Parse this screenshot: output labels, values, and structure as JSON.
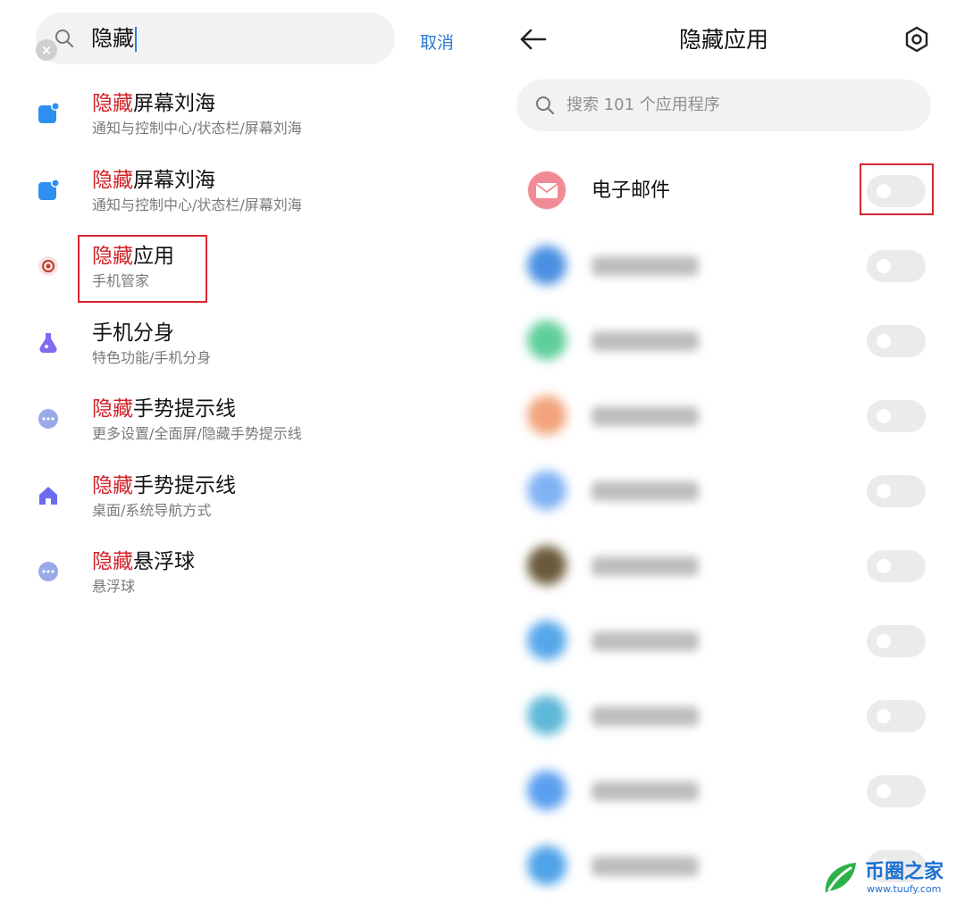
{
  "left": {
    "search": {
      "query": "隐藏",
      "cancel_label": "取消"
    },
    "results": [
      {
        "highlight": "隐藏",
        "rest": "屏幕刘海",
        "path": "通知与控制中心/状态栏/屏幕刘海",
        "icon": "notification-icon",
        "color": "#2f8ff0"
      },
      {
        "highlight": "隐藏",
        "rest": "屏幕刘海",
        "path": "通知与控制中心/状态栏/屏幕刘海",
        "icon": "notification-icon",
        "color": "#2f8ff0"
      },
      {
        "highlight": "隐藏",
        "rest": "应用",
        "path": "手机管家",
        "icon": "security-center-icon",
        "color": "#c0392b"
      },
      {
        "highlight": "",
        "rest": "手机分身",
        "path": "特色功能/手机分身",
        "icon": "second-space-icon",
        "color": "#7d6cf0"
      },
      {
        "highlight": "隐藏",
        "rest": "手势提示线",
        "path": "更多设置/全面屏/隐藏手势提示线",
        "icon": "more-settings-icon",
        "color": "#9aa9e8"
      },
      {
        "highlight": "隐藏",
        "rest": "手势提示线",
        "path": "桌面/系统导航方式",
        "icon": "home-icon",
        "color": "#6b6cf0"
      },
      {
        "highlight": "隐藏",
        "rest": "悬浮球",
        "path": "悬浮球",
        "icon": "more-settings-icon",
        "color": "#9aa9e8"
      }
    ]
  },
  "right": {
    "title": "隐藏应用",
    "search_placeholder": "搜索 101 个应用程序",
    "apps": [
      {
        "name": "电子邮件",
        "icon": "email-icon",
        "color": "#f08b95",
        "blurred": false,
        "enabled": false
      },
      {
        "name": "",
        "icon": "app-icon",
        "color": "#4a90e2",
        "blurred": true,
        "enabled": false
      },
      {
        "name": "",
        "icon": "app-icon",
        "color": "#5fcf9a",
        "blurred": true,
        "enabled": false
      },
      {
        "name": "",
        "icon": "app-icon",
        "color": "#f2a37a",
        "blurred": true,
        "enabled": false
      },
      {
        "name": "",
        "icon": "app-icon",
        "color": "#7fb2f5",
        "blurred": true,
        "enabled": false
      },
      {
        "name": "",
        "icon": "app-icon",
        "color": "#6b5a3a",
        "blurred": true,
        "enabled": false
      },
      {
        "name": "",
        "icon": "app-icon",
        "color": "#55a7ea",
        "blurred": true,
        "enabled": false
      },
      {
        "name": "",
        "icon": "app-icon",
        "color": "#5eb8d8",
        "blurred": true,
        "enabled": false
      },
      {
        "name": "",
        "icon": "app-icon",
        "color": "#5a9ff0",
        "blurred": true,
        "enabled": false
      },
      {
        "name": "",
        "icon": "app-icon",
        "color": "#4fa3e8",
        "blurred": true,
        "enabled": false
      }
    ]
  },
  "watermark": {
    "name": "币圈之家",
    "url": "www.tuufy.com"
  },
  "colors": {
    "highlight_red": "#d2232a",
    "accent_blue": "#2e7ad1",
    "annotation_box": "#d8262e"
  }
}
